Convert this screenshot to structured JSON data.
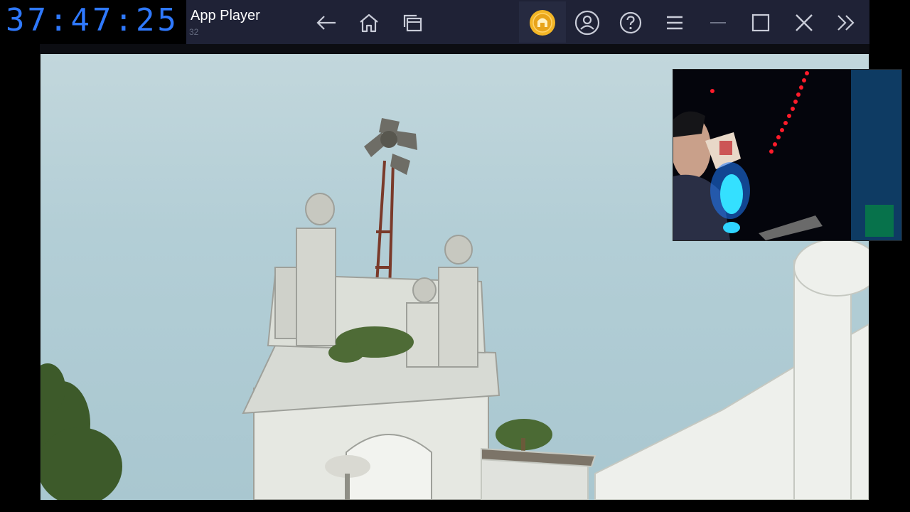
{
  "timer": {
    "value": "37:47:25"
  },
  "window": {
    "title": "App Player",
    "subtitle": "32"
  },
  "toolbar": {
    "back_icon": "arrow-left-icon",
    "home_icon": "home-icon",
    "recent_icon": "recent-apps-icon",
    "coin_icon": "coin-icon",
    "account_icon": "account-icon",
    "help_icon": "help-icon",
    "menu_icon": "hamburger-icon",
    "minimize_icon": "minimize-icon",
    "maximize_icon": "maximize-icon",
    "close_icon": "close-icon",
    "sidebar_icon": "double-chevron-right-icon"
  },
  "colors": {
    "titlebar": "#1f2236",
    "timer_text": "#2f79ff",
    "coin": "#f3b626",
    "sky": "#b3ced6"
  }
}
